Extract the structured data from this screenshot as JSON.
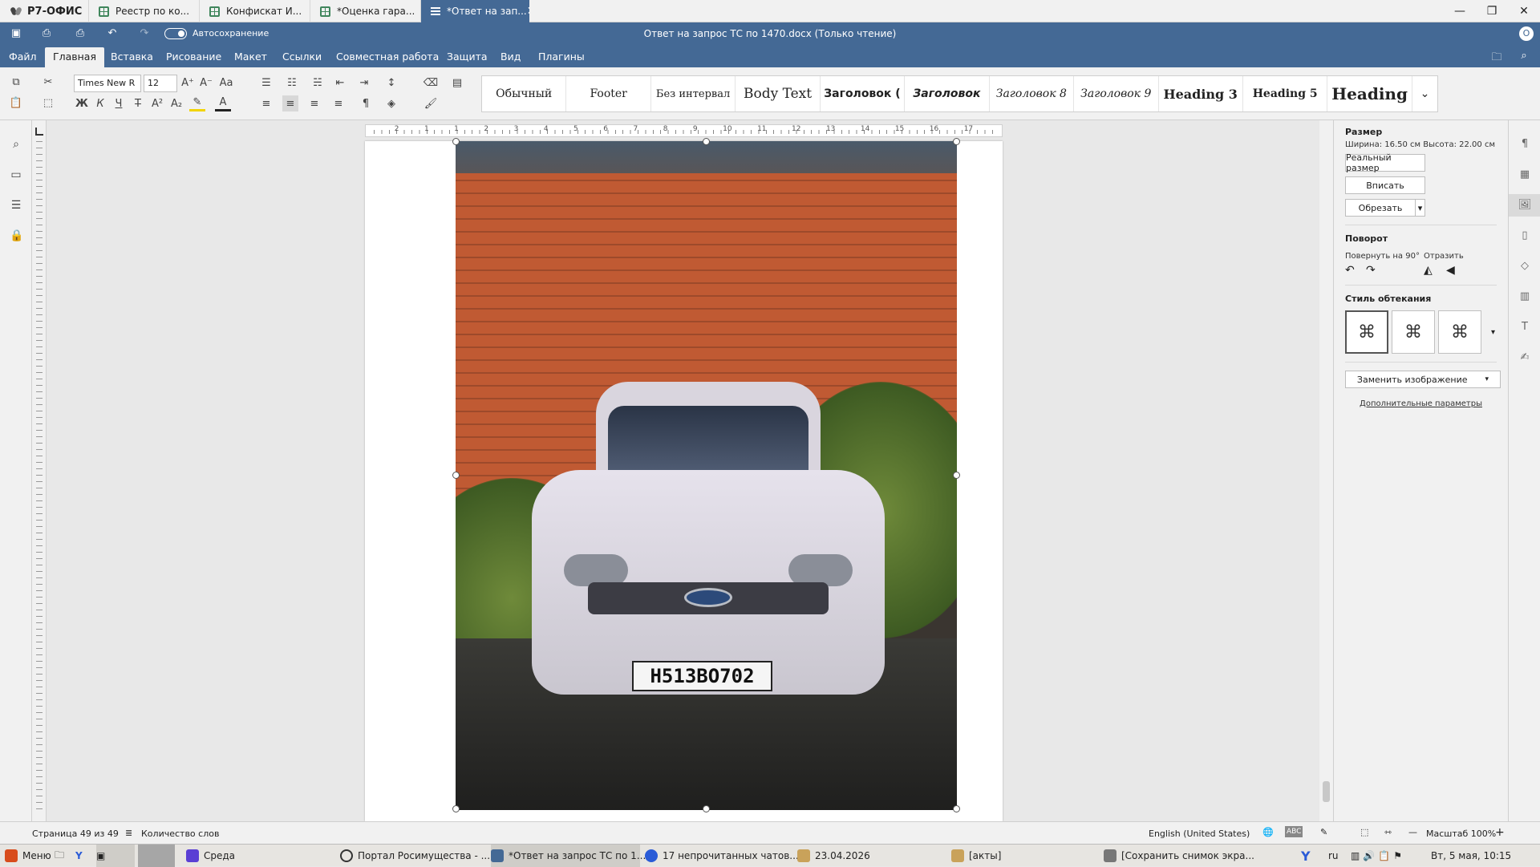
{
  "app": {
    "name": "Р7-ОФИС"
  },
  "tabs": [
    {
      "label": "Реестр по ко..."
    },
    {
      "label": "Конфискат И..."
    },
    {
      "label": "*Оценка гара..."
    },
    {
      "label": "*Ответ на зап..."
    }
  ],
  "title": {
    "text": "Ответ на запрос ТС по 1470.docx (Только чтение)",
    "autosave": "Автосохранение",
    "user_initial": "О"
  },
  "menu": [
    "Файл",
    "Главная",
    "Вставка",
    "Рисование",
    "Макет",
    "Ссылки",
    "Совместная работа",
    "Защита",
    "Вид",
    "Плагины"
  ],
  "font": {
    "family": "Times New R",
    "size": "12"
  },
  "styles": [
    {
      "label": "Обычный"
    },
    {
      "label": "Footer"
    },
    {
      "label": "Без интервал"
    },
    {
      "label": "Body Text"
    },
    {
      "label": "Заголовок (",
      "bold": true
    },
    {
      "label": "Заголовок",
      "bold": true,
      "italic": true
    },
    {
      "label": "Заголовок 8",
      "italic": true
    },
    {
      "label": "Заголовок 9",
      "italic": true
    },
    {
      "label": "Heading 3",
      "bold": true
    },
    {
      "label": "Heading 5",
      "bold": true
    },
    {
      "label": "Heading",
      "bold": true
    }
  ],
  "ruler": {
    "h": [
      "2",
      "1",
      "1",
      "2",
      "3",
      "4",
      "5",
      "6",
      "7",
      "8",
      "9",
      "10",
      "11",
      "12",
      "13",
      "14",
      "15",
      "16",
      "17"
    ]
  },
  "photo": {
    "plate": "Н513ВО702"
  },
  "panel": {
    "size_title": "Размер",
    "size_text": "Ширина: 16.50 см   Высота: 22.00 см",
    "real_size": "Реальный размер",
    "fit": "Вписать",
    "crop": "Обрезать",
    "rotation_title": "Поворот",
    "rotate90": "Повернуть на 90°",
    "flip": "Отразить",
    "wrap_title": "Стиль обтекания",
    "replace": "Заменить изображение",
    "more": "Дополнительные параметры"
  },
  "status": {
    "page": "Страница 49 из 49",
    "words": "Количество слов",
    "lang": "English (United States)",
    "zoom": "Масштаб 100%"
  },
  "taskbar": {
    "menu": "Меню",
    "items": [
      "Среда",
      "Портал Росимущества - ...",
      "*Ответ на запрос ТС по 1...",
      "17 непрочитанных чатов...",
      "23.04.2026",
      "[акты]",
      "[Сохранить снимок экра..."
    ],
    "lang": "ru",
    "clock": "Вт, 5 мая, 10:15"
  },
  "colors": {
    "accent": "#446995",
    "sheet": "#40865c"
  }
}
